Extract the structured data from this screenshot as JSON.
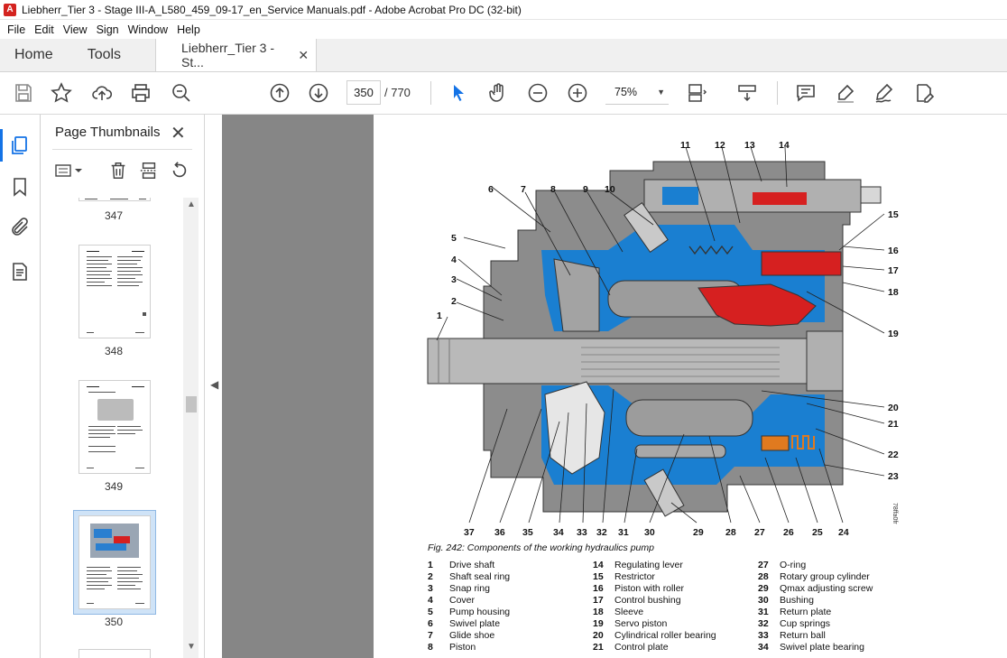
{
  "window": {
    "title": "Liebherr_Tier 3 - Stage III-A_L580_459_09-17_en_Service Manuals.pdf - Adobe Acrobat Pro DC (32-bit)",
    "app_icon_letter": "A"
  },
  "menu": [
    "File",
    "Edit",
    "View",
    "Sign",
    "Window",
    "Help"
  ],
  "tabs": {
    "home": "Home",
    "tools": "Tools",
    "document": "Liebherr_Tier 3 - St...",
    "close_glyph": "✕"
  },
  "toolbar": {
    "current_page": "350",
    "total_pages": "/ 770",
    "zoom": "75%",
    "icons": [
      "save-icon",
      "bookmark-star-icon",
      "upload-icon",
      "print-icon",
      "search-zoom-icon",
      "page-up-icon",
      "page-down-icon",
      "cursor-icon",
      "hand-icon",
      "zoom-out-icon",
      "zoom-in-icon",
      "fit-page-icon",
      "scroll-mode-icon",
      "comment-icon",
      "highlight-icon",
      "sign-icon",
      "edit-pdf-icon"
    ]
  },
  "panel": {
    "title": "Page Thumbnails",
    "thumbnails": [
      {
        "label": "347"
      },
      {
        "label": "348"
      },
      {
        "label": "349"
      },
      {
        "label": "350",
        "selected": true
      }
    ]
  },
  "document": {
    "figure_caption": "Fig. 242: Components of the working hydraulics pump",
    "side_code": "78ffa0fr",
    "callouts_top": [
      "11",
      "12",
      "13",
      "14"
    ],
    "callouts_topleft": [
      "6",
      "7",
      "8",
      "9",
      "10"
    ],
    "callouts_left": [
      "5",
      "4",
      "3",
      "2",
      "1"
    ],
    "callouts_right": [
      "15",
      "16",
      "17",
      "18",
      "19",
      "20",
      "21",
      "22",
      "23"
    ],
    "callouts_bottom": [
      "37",
      "36",
      "35",
      "34",
      "33",
      "32",
      "31",
      "30",
      "29",
      "28",
      "27",
      "26",
      "25",
      "24"
    ],
    "legend": [
      [
        {
          "n": "1",
          "t": "Drive shaft"
        },
        {
          "n": "2",
          "t": "Shaft seal ring"
        },
        {
          "n": "3",
          "t": "Snap ring"
        },
        {
          "n": "4",
          "t": "Cover"
        },
        {
          "n": "5",
          "t": "Pump housing"
        },
        {
          "n": "6",
          "t": "Swivel plate"
        },
        {
          "n": "7",
          "t": "Glide shoe"
        },
        {
          "n": "8",
          "t": "Piston"
        }
      ],
      [
        {
          "n": "14",
          "t": "Regulating lever"
        },
        {
          "n": "15",
          "t": "Restrictor"
        },
        {
          "n": "16",
          "t": "Piston with roller"
        },
        {
          "n": "17",
          "t": "Control bushing"
        },
        {
          "n": "18",
          "t": "Sleeve"
        },
        {
          "n": "19",
          "t": "Servo piston"
        },
        {
          "n": "20",
          "t": "Cylindrical roller bearing"
        },
        {
          "n": "21",
          "t": "Control plate"
        }
      ],
      [
        {
          "n": "27",
          "t": "O-ring"
        },
        {
          "n": "28",
          "t": "Rotary group cylinder"
        },
        {
          "n": "29",
          "t": "Qmax adjusting screw"
        },
        {
          "n": "30",
          "t": "Bushing"
        },
        {
          "n": "31",
          "t": "Return plate"
        },
        {
          "n": "32",
          "t": "Cup springs"
        },
        {
          "n": "33",
          "t": "Return ball"
        },
        {
          "n": "34",
          "t": "Swivel plate bearing"
        }
      ]
    ]
  },
  "colors": {
    "accent": "#1473e6",
    "hydraulic_blue": "#1a7fd1",
    "pressure_red": "#d62020",
    "housing_gray": "#8c8c8c",
    "spring_orange": "#e07a1f",
    "canvas_gray": "#868686"
  }
}
